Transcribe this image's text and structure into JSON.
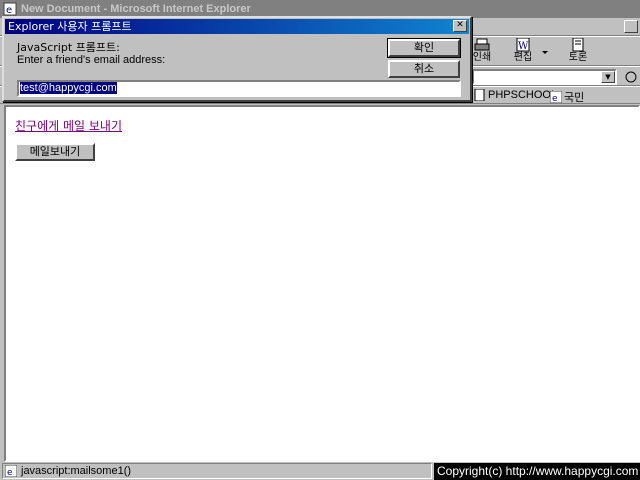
{
  "window": {
    "title": "New Document - Microsoft Internet Explorer",
    "toolbar": [
      {
        "label": "인쇄",
        "icon": "print-icon"
      },
      {
        "label": "편집",
        "icon": "edit-icon"
      },
      {
        "label": "토론",
        "icon": "discuss-icon"
      }
    ],
    "links": [
      {
        "label": "PHPSCHOOL",
        "icon": "page-icon"
      },
      {
        "label": "국민",
        "icon": "ie-page-icon"
      }
    ]
  },
  "page": {
    "link_text": "친구에게 메일 보내기",
    "button_label": "메일보내기"
  },
  "dialog": {
    "title": "Explorer 사용자 프롬프트",
    "message_line1": "JavaScript 프롬프트:",
    "message_line2": "Enter a friend's email address:",
    "ok_label": "확인",
    "cancel_label": "취소",
    "input_value": "test@happycgi.com"
  },
  "status": {
    "text": "javascript:mailsome1()",
    "copyright": "Copyright(c) http://www.happycgi.com"
  },
  "colors": {
    "dialog_title_bg": "#000080",
    "link_visited": "#800080",
    "face": "#c0c0c0"
  }
}
